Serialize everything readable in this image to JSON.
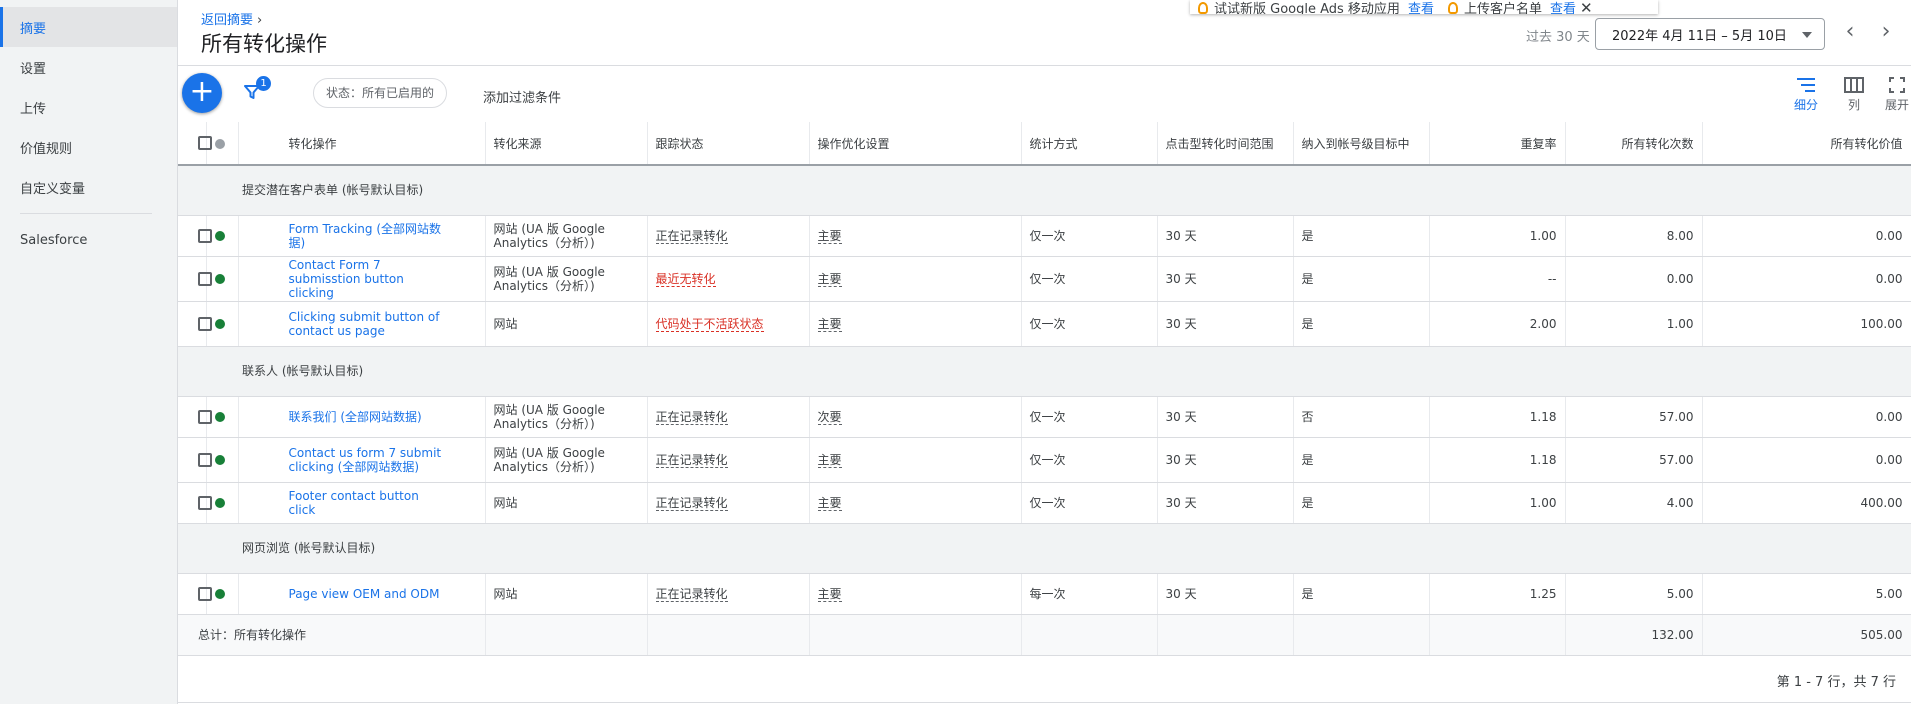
{
  "sidebar": {
    "items": [
      {
        "label": "摘要",
        "active": true
      },
      {
        "label": "设置"
      },
      {
        "label": "上传"
      },
      {
        "label": "价值规则"
      },
      {
        "label": "自定义变量"
      }
    ],
    "extra": {
      "label": "Salesforce"
    }
  },
  "header": {
    "breadcrumb": "返回摘要",
    "title": "所有转化操作",
    "date_label": "过去 30 天",
    "date_range": "2022年 4月 11日 – 5月 10日"
  },
  "notifications": [
    {
      "text": "试试新版 Google Ads 移动应用",
      "link": "查看"
    },
    {
      "text": "上传客户名单",
      "link": "查看"
    }
  ],
  "toolbar": {
    "filter_count": "1",
    "status_chip": "状态：所有已启用的",
    "add_filter": "添加过滤条件",
    "segment_label": "细分",
    "columns_label": "列",
    "expand_label": "展开"
  },
  "table": {
    "headers": {
      "action": "转化操作",
      "source": "转化来源",
      "tracking": "跟踪状态",
      "optimization": "操作优化设置",
      "count": "统计方式",
      "window": "点击型转化时间范围",
      "include": "纳入到帐号级目标中",
      "repeat": "重复率",
      "all_conv": "所有转化次数",
      "all_value": "所有转化价值"
    },
    "groups": [
      {
        "name": "提交潜在客户表单 (帐号默认目标)",
        "rows": [
          {
            "action": "Form Tracking (全部网站数据)",
            "source": "网站 (UA 版 Google Analytics（分析）)",
            "tracking": "正在记录转化",
            "tracking_warn": false,
            "optimization": "主要",
            "count": "仅一次",
            "window": "30 天",
            "include": "是",
            "repeat": "1.00",
            "all_conv": "8.00",
            "all_value": "0.00"
          },
          {
            "action": "Contact Form 7 submisstion button clicking",
            "source": "网站 (UA 版 Google Analytics（分析）)",
            "tracking": "最近无转化",
            "tracking_warn": true,
            "optimization": "主要",
            "count": "仅一次",
            "window": "30 天",
            "include": "是",
            "repeat": "--",
            "all_conv": "0.00",
            "all_value": "0.00"
          },
          {
            "action": "Clicking submit button of contact us page",
            "source": "网站",
            "tracking": "代码处于不活跃状态",
            "tracking_warn": true,
            "optimization": "主要",
            "count": "仅一次",
            "window": "30 天",
            "include": "是",
            "repeat": "2.00",
            "all_conv": "1.00",
            "all_value": "100.00"
          }
        ]
      },
      {
        "name": "联系人 (帐号默认目标)",
        "rows": [
          {
            "action": "联系我们 (全部网站数据)",
            "source": "网站 (UA 版 Google Analytics（分析）)",
            "tracking": "正在记录转化",
            "tracking_warn": false,
            "optimization": "次要",
            "count": "仅一次",
            "window": "30 天",
            "include": "否",
            "repeat": "1.18",
            "all_conv": "57.00",
            "all_value": "0.00"
          },
          {
            "action": "Contact us form 7 submit clicking (全部网站数据)",
            "source": "网站 (UA 版 Google Analytics（分析）)",
            "tracking": "正在记录转化",
            "tracking_warn": false,
            "optimization": "主要",
            "count": "仅一次",
            "window": "30 天",
            "include": "是",
            "repeat": "1.18",
            "all_conv": "57.00",
            "all_value": "0.00"
          },
          {
            "action": "Footer contact button click",
            "source": "网站",
            "tracking": "正在记录转化",
            "tracking_warn": false,
            "optimization": "主要",
            "count": "仅一次",
            "window": "30 天",
            "include": "是",
            "repeat": "1.00",
            "all_conv": "4.00",
            "all_value": "400.00"
          }
        ]
      },
      {
        "name": "网页浏览 (帐号默认目标)",
        "rows": [
          {
            "action": "Page view OEM and ODM",
            "source": "网站",
            "tracking": "正在记录转化",
            "tracking_warn": false,
            "optimization": "主要",
            "count": "每一次",
            "window": "30 天",
            "include": "是",
            "repeat": "1.25",
            "all_conv": "5.00",
            "all_value": "5.00"
          }
        ]
      }
    ],
    "total": {
      "label": "总计：所有转化操作",
      "all_conv": "132.00",
      "all_value": "505.00"
    },
    "pager": "第 1 - 7 行，共 7 行"
  },
  "colors": {
    "accent": "#1a73e8",
    "enabled_dot": "#188038",
    "warning": "#d93025"
  }
}
